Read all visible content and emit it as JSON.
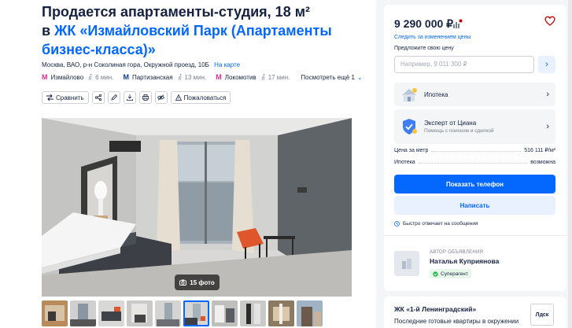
{
  "listing": {
    "title_line1": "Продается апартаменты-студия, 18 м²",
    "title_prefix": "в ",
    "title_complex": "ЖК «Измайловский Парк (Апартаменты бизнес-класса)»",
    "address": "Москва, ВАО, р-н Соколиная гора, Окружной проезд, 10Б",
    "map_link": "На карте",
    "metros": [
      {
        "name": "Измайлово",
        "walk": "6 мин.",
        "color": "#e4308a"
      },
      {
        "name": "Партизанская",
        "walk": "13 мин.",
        "color": "#0a3aa8"
      },
      {
        "name": "Локомотив",
        "walk": "17 мин.",
        "color": "#e4308a"
      }
    ],
    "see_more": "Посмотреть ещё 1",
    "actions": {
      "compare": "Сравнить",
      "complain": "Пожаловаться"
    },
    "photo_count": "15 фото"
  },
  "sidebar": {
    "price": "9 290 000 ₽",
    "follow_price": "Следить за изменением цены",
    "offer_label": "Предложите свою цену",
    "offer_placeholder": "Например, 9 011 300 ₽",
    "mortgage": "Ипотека",
    "expert_title": "Эксперт от Циана",
    "expert_sub": "Помощь с поиском и сделкой",
    "price_per_m_label": "Цена за метр",
    "price_per_m_value": "516 111 ₽/м²",
    "mortgage_label": "Ипотека",
    "mortgage_value": "возможна",
    "show_phone": "Показать телефон",
    "write": "Написать",
    "fast_reply": "Быстро отвечает на сообщения",
    "author_caption": "АВТОР ОБЪЯВЛЕНИЯ",
    "author_name": "Наталья Куприянова",
    "author_badge": "Суперагент"
  },
  "complex_card": {
    "title": "ЖК «1-й Ленинградский»",
    "subtitle": "Последние готовые квартиры в окружении",
    "logo_text": "Лдск"
  },
  "colors": {
    "accent": "#0468ff",
    "text": "#152242",
    "heart": "#c00000"
  }
}
